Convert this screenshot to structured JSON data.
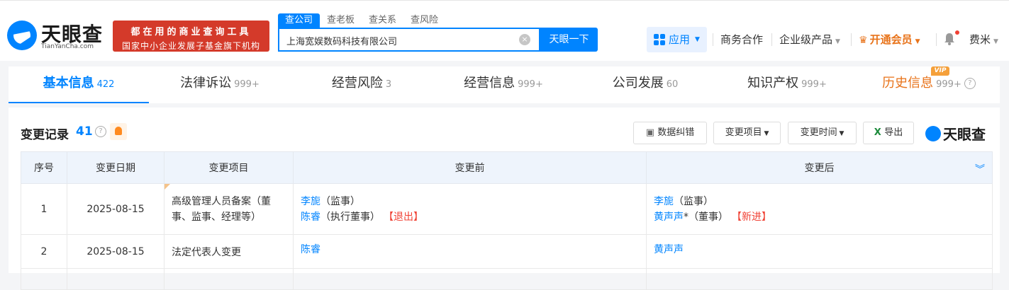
{
  "header": {
    "logo_cn": "天眼查",
    "logo_en": "TianYanCha.com",
    "slogan_line1": "都在用的商业查询工具",
    "slogan_line2": "国家中小企业发展子基金旗下机构",
    "search_tabs": [
      "查公司",
      "查老板",
      "查关系",
      "查风险"
    ],
    "search_value": "上海宽娱数码科技有限公司",
    "search_button": "天眼一下",
    "apps_label": "应用",
    "nav": {
      "business": "商务合作",
      "enterprise": "企业级产品",
      "vip": "开通会员",
      "user": "费米"
    }
  },
  "main_tabs": [
    {
      "label": "基本信息",
      "count": "422"
    },
    {
      "label": "法律诉讼",
      "count": "999+"
    },
    {
      "label": "经营风险",
      "count": "3"
    },
    {
      "label": "经营信息",
      "count": "999+"
    },
    {
      "label": "公司发展",
      "count": "60"
    },
    {
      "label": "知识产权",
      "count": "999+"
    },
    {
      "label": "历史信息",
      "count": "999+",
      "badge": "VIP"
    }
  ],
  "section": {
    "title": "变更记录",
    "count": "41",
    "btn_report": "数据纠错",
    "btn_item": "变更项目",
    "btn_time": "变更时间",
    "btn_export": "导出",
    "brand": "天眼查"
  },
  "table": {
    "headers": [
      "序号",
      "变更日期",
      "变更项目",
      "变更前",
      "变更后"
    ],
    "rows": [
      {
        "no": "1",
        "date": "2025-08-15",
        "item": "高级管理人员备案（董事、监事、经理等）",
        "before": [
          {
            "name": "李旎",
            "role": "（监事）",
            "tag": ""
          },
          {
            "name": "陈睿",
            "role": "（执行董事）",
            "tag": "【退出】"
          }
        ],
        "after": [
          {
            "name": "李旎",
            "role": "（监事）",
            "tag": ""
          },
          {
            "name": "黄声声",
            "role": "*（董事）",
            "tag": "【新进】"
          }
        ]
      },
      {
        "no": "2",
        "date": "2025-08-15",
        "item": "法定代表人变更",
        "before": [
          {
            "name": "陈睿",
            "role": "",
            "tag": ""
          }
        ],
        "after": [
          {
            "name": "黄声声",
            "role": "",
            "tag": ""
          }
        ]
      }
    ]
  },
  "colors": {
    "primary": "#0084ff",
    "slogan_bg": "#d43a2a",
    "vip": "#e8731a",
    "danger": "#f04134"
  }
}
